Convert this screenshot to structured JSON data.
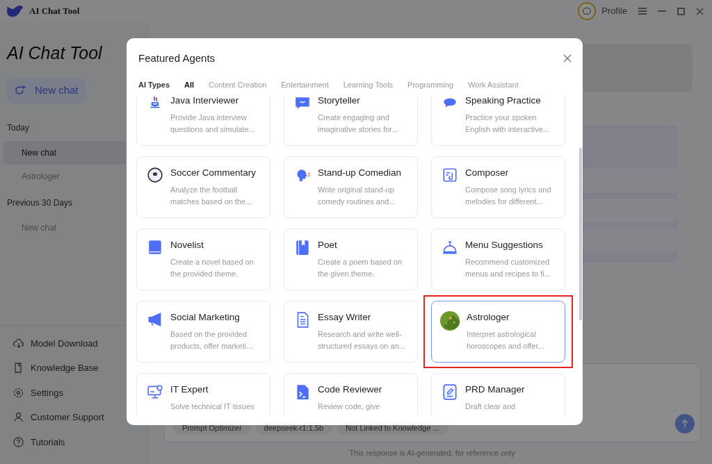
{
  "window": {
    "title": "AI Chat Tool",
    "profile": "Profile"
  },
  "sidebar": {
    "title": "AI Chat Tool",
    "new_chat": "New chat",
    "groups": [
      {
        "label": "Today",
        "items": [
          {
            "label": "New chat",
            "selected": true
          },
          {
            "label": "Astrologer",
            "selected": false
          }
        ]
      },
      {
        "label": "Previous 30 Days",
        "items": [
          {
            "label": "New chat",
            "selected": false
          }
        ]
      }
    ],
    "menu": [
      "Model Download",
      "Knowledge Base",
      "Settings",
      "Customer Support",
      "Tutorials"
    ]
  },
  "composer": {
    "chips": [
      "Prompt Optimizer",
      "deepseek-r1:1.5b",
      "Not Linked to Knowledge ..."
    ],
    "footer": "This response is AI-generated, for reference only"
  },
  "dialog": {
    "title": "Featured Agents",
    "filter_label": "AI Types",
    "tabs": [
      {
        "label": "All",
        "selected": true
      },
      {
        "label": "Content Creation",
        "selected": false
      },
      {
        "label": "Entertainment",
        "selected": false
      },
      {
        "label": "Learning Tools",
        "selected": false
      },
      {
        "label": "Programming",
        "selected": false
      },
      {
        "label": "Work Assistant",
        "selected": false
      }
    ],
    "agents": [
      {
        "name": "Java Interviewer",
        "description": "Provide Java interview questions and simulate...",
        "selected": false,
        "highlighted": false
      },
      {
        "name": "Storyteller",
        "description": "Create engaging and imaginative stories for...",
        "selected": false,
        "highlighted": false
      },
      {
        "name": "Speaking Practice",
        "description": "Practice your spoken English with interactive...",
        "selected": false,
        "highlighted": false
      },
      {
        "name": "Soccer Commentary",
        "description": "Analyze the football matches based on the...",
        "selected": false,
        "highlighted": false
      },
      {
        "name": "Stand-up Comedian",
        "description": "Write original stand-up comedy routines and...",
        "selected": false,
        "highlighted": false
      },
      {
        "name": "Composer",
        "description": "Compose song lyrics and melodies for different...",
        "selected": false,
        "highlighted": false
      },
      {
        "name": "Novelist",
        "description": "Create a novel based on the provided theme.",
        "selected": false,
        "highlighted": false
      },
      {
        "name": "Poet",
        "description": "Create a poem based on the given theme.",
        "selected": false,
        "highlighted": false
      },
      {
        "name": "Menu Suggestions",
        "description": "Recommend customized menus and recipes to fi...",
        "selected": false,
        "highlighted": false
      },
      {
        "name": "Social Marketing",
        "description": "Based on the provided products, offer marketi...",
        "selected": false,
        "highlighted": false
      },
      {
        "name": "Essay Writer",
        "description": "Research and write well-structured essays on an...",
        "selected": false,
        "highlighted": false
      },
      {
        "name": "Astrologer",
        "description": "Interpret astrological horoscopes and offer...",
        "selected": true,
        "highlighted": true
      },
      {
        "name": "IT Expert",
        "description": "Solve technical IT issues",
        "selected": false,
        "highlighted": false
      },
      {
        "name": "Code Reviewer",
        "description": "Review code, give",
        "selected": false,
        "highlighted": false
      },
      {
        "name": "PRD Manager",
        "description": "Draft clear and",
        "selected": false,
        "highlighted": false
      }
    ]
  }
}
